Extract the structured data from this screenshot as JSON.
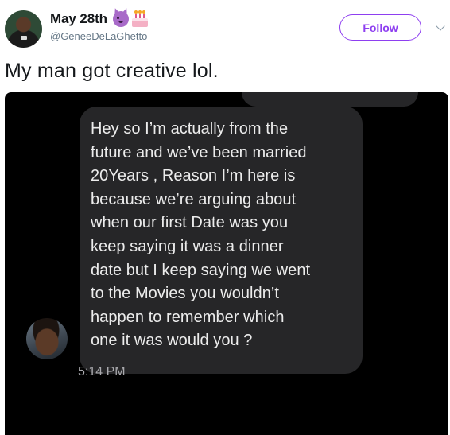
{
  "tweet": {
    "display_name": "May 28th",
    "name_emojis": [
      "smiling-devil-emoji",
      "birthday-cake-emoji"
    ],
    "handle": "@GeneeDeLaGhetto",
    "follow_label": "Follow",
    "text": "My man got creative lol.",
    "accent_color": "#8e3ff0"
  },
  "message": {
    "text": "Hey so I’m actually from the\nfuture and we’ve been married\n20Years , Reason I’m here is\nbecause we’re arguing about\nwhen our first Date was you\nkeep saying it was a dinner\ndate but I keep saying we went\nto the Movies you wouldn’t\nhappen to remember which\none it was would you ?",
    "time": "5:14 PM",
    "bubble_color": "#262628",
    "background_color": "#000000"
  }
}
